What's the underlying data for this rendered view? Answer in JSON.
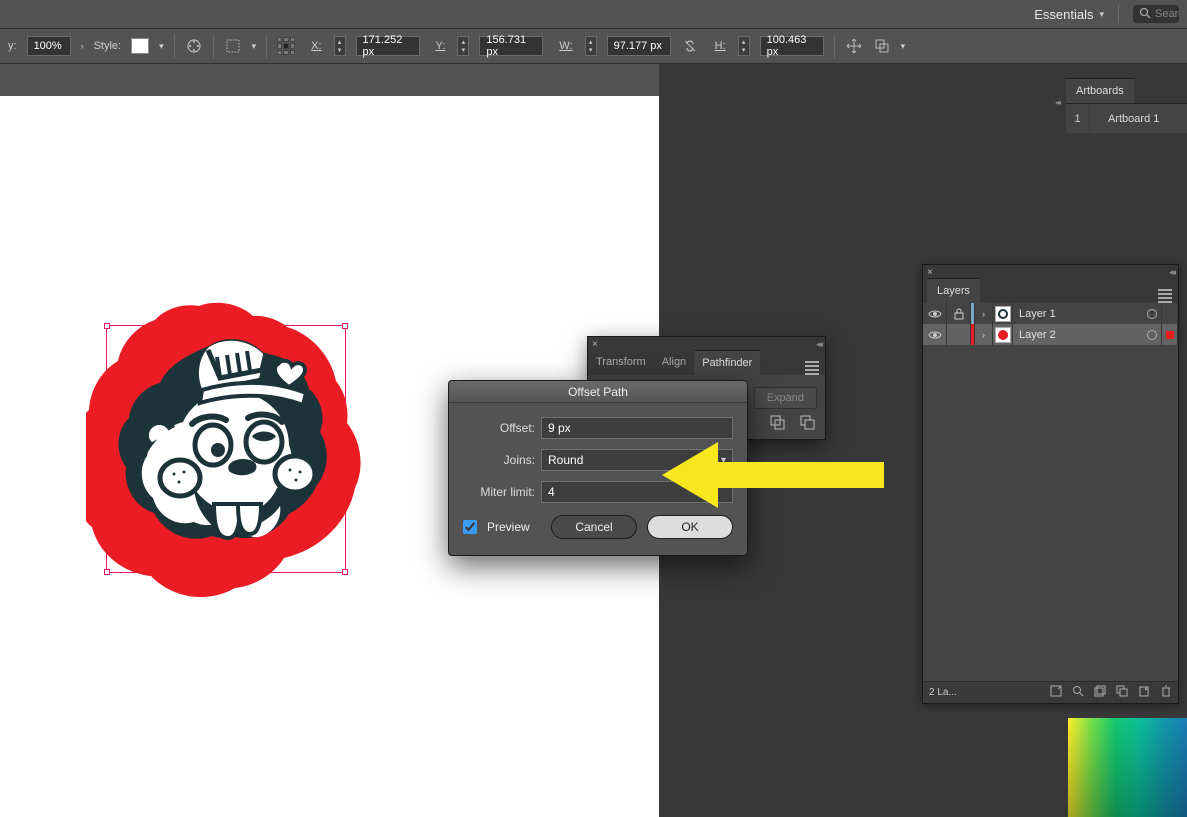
{
  "menubar": {
    "workspace": "Essentials",
    "search_placeholder": "Search"
  },
  "controlbar": {
    "opacity_label": "y:",
    "opacity_value": "100%",
    "style_label": "Style:",
    "x_label": "X:",
    "x_value": "171.252 px",
    "y_label": "Y:",
    "y_value": "156.731 px",
    "w_label": "W:",
    "w_value": "97.177 px",
    "h_label": "H:",
    "h_value": "100.463 px"
  },
  "artboards": {
    "tab": "Artboards",
    "items": [
      {
        "num": "1",
        "name": "Artboard 1"
      }
    ]
  },
  "layers": {
    "tab": "Layers",
    "rows": [
      {
        "name": "Layer 1",
        "color": "#7aa8c9",
        "locked": true,
        "selected": false
      },
      {
        "name": "Layer 2",
        "color": "#ec1c24",
        "locked": false,
        "selected": true
      }
    ],
    "footer_text": "2 La..."
  },
  "pathfinder": {
    "tabs": {
      "transform": "Transform",
      "align": "Align",
      "pathfinder": "Pathfinder"
    },
    "expand": "Expand"
  },
  "dialog": {
    "title": "Offset Path",
    "offset_label": "Offset:",
    "offset_value": "9 px",
    "joins_label": "Joins:",
    "joins_value": "Round",
    "miter_label": "Miter limit:",
    "miter_value": "4",
    "preview_label": "Preview",
    "preview_checked": true,
    "cancel": "Cancel",
    "ok": "OK"
  },
  "colors": {
    "selection": "#ed145b",
    "annotation": "#f8e71c"
  }
}
